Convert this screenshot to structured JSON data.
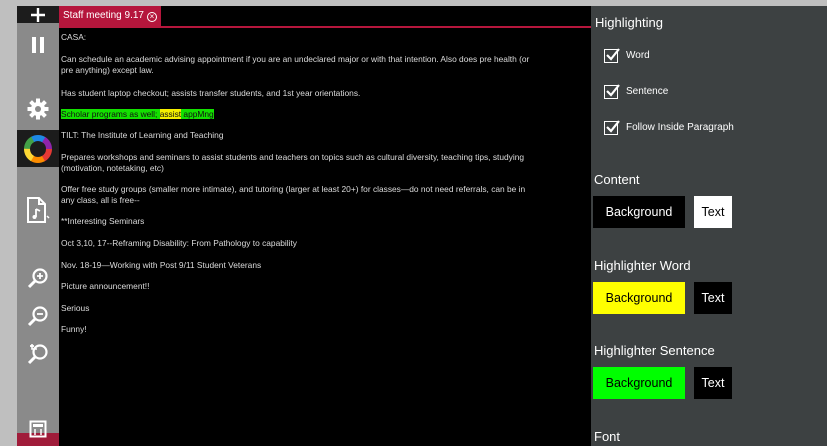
{
  "document": {
    "tab_title": "Staff meeting 9.17",
    "close_symbol": "×",
    "paragraphs": [
      "CASA:",
      "Can schedule an academic advising appointment if you are an undeclared major or with that intention. Also does pre health (or",
      "pre anything) except law.",
      "Has student laptop checkout; assists transfer students, and 1st year orientations.",
      "TILT: The Institute of Learning and Teaching",
      "Prepares workshops and seminars to assist students and teachers on topics such as cultural diversity, teaching tips, studying",
      "(motivation, notetaking, etc)",
      "Offer free study groups (smaller more intimate), and tutoring (larger at least 20+) for classes—do not need referrals, can be in",
      "any class, all is free--",
      "**Interesting Seminars",
      "Oct 3,10, 17--Reframing Disability: From Pathology to capability",
      "Nov. 18-19—Working with Post 9/11 Student Veterans",
      "Picture announcement!!",
      "Serious",
      "Funny!"
    ],
    "highlighted_line": {
      "before": "Scholar programs as well; ",
      "word": "assist",
      "after": " appMng"
    }
  },
  "toolbar": {
    "icons": [
      "add-icon",
      "pause-icon",
      "gear-icon",
      "color-wheel-icon",
      "audio-file-icon",
      "zoom-in-icon",
      "zoom-out-icon",
      "reset-zoom-icon",
      "book-icon"
    ]
  },
  "settings": {
    "highlighting_heading": "Highlighting",
    "options": [
      {
        "label": "Word",
        "checked": true
      },
      {
        "label": "Sentence",
        "checked": true
      },
      {
        "label": "Follow Inside Paragraph",
        "checked": true
      }
    ],
    "content": {
      "heading": "Content",
      "background_label": "Background",
      "text_label": "Text",
      "background_color": "#000000",
      "text_color": "#ffffff"
    },
    "highlighter_word": {
      "heading": "Highlighter Word",
      "background_label": "Background",
      "text_label": "Text",
      "background_color": "#ffff00",
      "text_color": "#000000"
    },
    "highlighter_sentence": {
      "heading": "Highlighter Sentence",
      "background_label": "Background",
      "text_label": "Text",
      "background_color": "#00ff00",
      "text_color": "#000000"
    },
    "font_heading": "Font"
  }
}
